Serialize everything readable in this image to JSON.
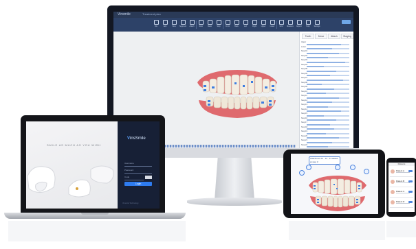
{
  "desktop": {
    "app_title": "Vinsmile",
    "tab_label": "Treatment plan",
    "toolbar": [
      "File",
      "Edit",
      "View",
      "Segment",
      "Attach",
      "Undo",
      "Redo",
      "Step",
      "Front",
      "Back",
      "Left",
      "Right",
      "Upper",
      "Lower",
      "Grid",
      "Measure",
      "Export",
      "Help",
      "Settings"
    ],
    "panel_tabs": [
      "Tooth",
      "Move",
      "Attach",
      "Staging"
    ],
    "panel_rows": [
      {
        "label": "Upper",
        "fill": 0.8
      },
      {
        "label": "Lower",
        "fill": 0.6
      },
      {
        "label": "Step 01",
        "fill": 0.75
      },
      {
        "label": "Step 02",
        "fill": 0.5
      },
      {
        "label": "Step 03",
        "fill": 0.9
      },
      {
        "label": "Step 04",
        "fill": 0.4
      },
      {
        "label": "Step 05",
        "fill": 0.7
      },
      {
        "label": "Step 06",
        "fill": 0.55
      },
      {
        "label": "Step 07",
        "fill": 0.85
      },
      {
        "label": "Step 08",
        "fill": 0.35
      },
      {
        "label": "Step 09",
        "fill": 0.65
      },
      {
        "label": "Step 10",
        "fill": 0.45
      },
      {
        "label": "Step 11",
        "fill": 0.75
      },
      {
        "label": "Step 12",
        "fill": 0.6
      },
      {
        "label": "Step 13",
        "fill": 0.5
      },
      {
        "label": "Step 14",
        "fill": 0.8
      },
      {
        "label": "Step 15",
        "fill": 0.4
      },
      {
        "label": "Step 16",
        "fill": 0.7
      },
      {
        "label": "Step 17",
        "fill": 0.55
      },
      {
        "label": "Step 18",
        "fill": 0.65
      },
      {
        "label": "Step 19",
        "fill": 0.45
      },
      {
        "label": "Step 20",
        "fill": 0.75
      },
      {
        "label": "Step 21",
        "fill": 0.6
      },
      {
        "label": "Step 22",
        "fill": 0.5
      }
    ],
    "confirm_label": ""
  },
  "laptop": {
    "slogan": "SMILE AS MUCH AS YOU WISH",
    "brand_mark": "V",
    "brand_text": "insSmile",
    "field_user": "Username",
    "field_pass": "Password",
    "field_code": "Code",
    "login_button": "Login",
    "footer": "Vinsmile Technology"
  },
  "tablet": {
    "callout": "Attachment 11 · 12 · 13 added at step 3"
  },
  "phone": {
    "header": "Patients",
    "cards": [
      {
        "name": "Patient A"
      },
      {
        "name": "Patient B"
      },
      {
        "name": "Patient C"
      },
      {
        "name": "Patient D"
      }
    ]
  },
  "colors": {
    "toolbar": "#2d4268",
    "accent": "#2e7cf0",
    "login_bg": "#172036",
    "gum": "#e0696f"
  }
}
